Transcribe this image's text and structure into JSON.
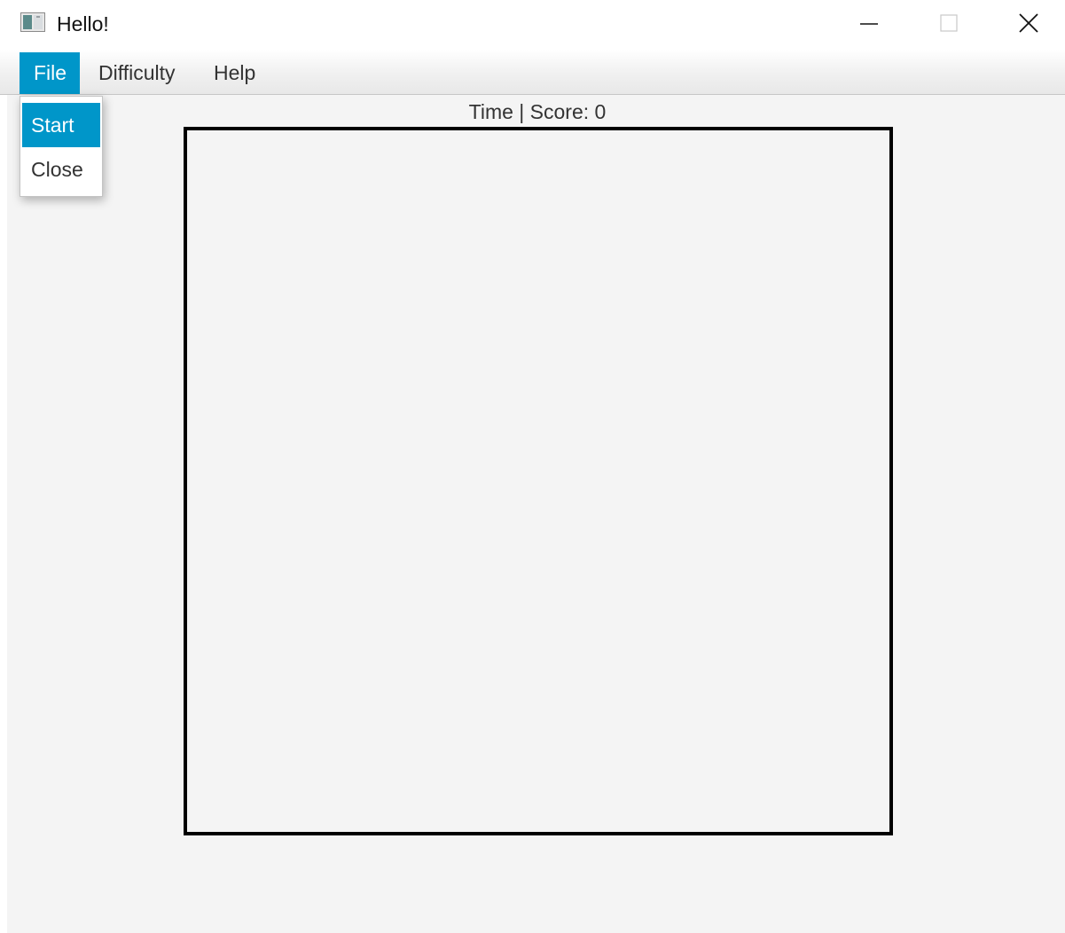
{
  "window": {
    "title": "Hello!",
    "icon": "app-window-icon"
  },
  "window_controls": {
    "minimize_icon": "minimize-icon",
    "maximize_icon": "maximize-icon",
    "close_icon": "close-icon"
  },
  "menubar": {
    "items": [
      {
        "label": "File",
        "active": true
      },
      {
        "label": "Difficulty",
        "active": false
      },
      {
        "label": "Help",
        "active": false
      }
    ]
  },
  "file_menu": {
    "items": [
      {
        "label": "Start",
        "highlighted": true
      },
      {
        "label": "Close",
        "highlighted": false
      }
    ]
  },
  "status": {
    "text": "Time | Score: 0"
  },
  "colors": {
    "accent": "#0096c9",
    "background": "#f4f4f4",
    "board_border": "#000000"
  }
}
